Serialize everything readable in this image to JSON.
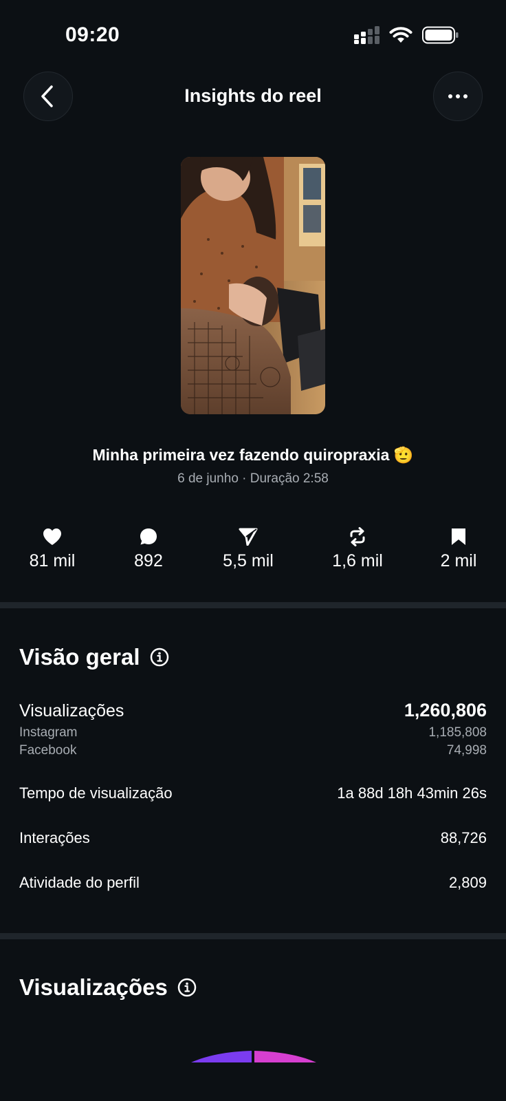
{
  "status_bar": {
    "time": "09:20"
  },
  "header": {
    "title": "Insights do reel"
  },
  "reel": {
    "caption": "Minha primeira vez fazendo quiropraxia 🫡",
    "meta": "6 de junho · Duração 2:58"
  },
  "stats": [
    {
      "icon": "heart-icon",
      "value": "81 mil"
    },
    {
      "icon": "comment-icon",
      "value": "892"
    },
    {
      "icon": "share-icon",
      "value": "5,5 mil"
    },
    {
      "icon": "repost-icon",
      "value": "1,6 mil"
    },
    {
      "icon": "bookmark-icon",
      "value": "2 mil"
    }
  ],
  "overview": {
    "title": "Visão geral",
    "views": {
      "label": "Visualizações",
      "value": "1,260,806",
      "instagram_label": "Instagram",
      "instagram_value": "1,185,808",
      "facebook_label": "Facebook",
      "facebook_value": "74,998"
    },
    "watch_time": {
      "label": "Tempo de visualização",
      "value": "1a 88d 18h 43min 26s"
    },
    "interactions": {
      "label": "Interações",
      "value": "88,726"
    },
    "profile_activity": {
      "label": "Atividade do perfil",
      "value": "2,809"
    }
  },
  "views_section": {
    "title": "Visualizações"
  },
  "colors": {
    "background": "#0c1014",
    "muted_text": "#a8adb3",
    "divider": "#1f252b",
    "gauge_purple": "#7b3cf0",
    "gauge_magenta": "#d63fd0"
  }
}
